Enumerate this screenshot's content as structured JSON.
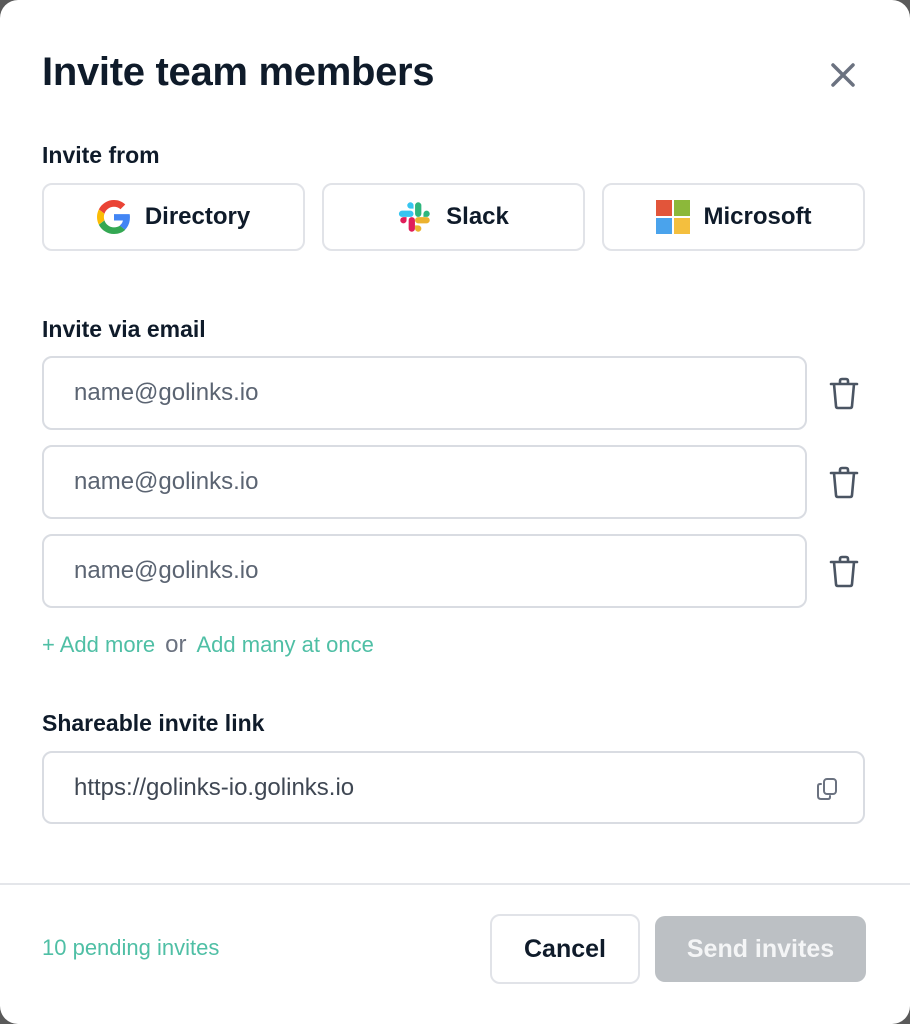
{
  "modal": {
    "title": "Invite team members",
    "close_icon": "close-icon"
  },
  "invite_from": {
    "label": "Invite from",
    "providers": [
      {
        "label": "Directory",
        "icon": "google-icon"
      },
      {
        "label": "Slack",
        "icon": "slack-icon"
      },
      {
        "label": "Microsoft",
        "icon": "microsoft-icon"
      }
    ]
  },
  "invite_email": {
    "label": "Invite via email",
    "fields": [
      {
        "placeholder": "name@golinks.io",
        "value": ""
      },
      {
        "placeholder": "name@golinks.io",
        "value": ""
      },
      {
        "placeholder": "name@golinks.io",
        "value": ""
      }
    ],
    "delete_icon": "trash-icon",
    "add_more": "+ Add more",
    "or": "or",
    "add_many": "Add many at once"
  },
  "shareable_link": {
    "label": "Shareable invite link",
    "url": "https://golinks-io.golinks.io",
    "copy_icon": "copy-icon"
  },
  "footer": {
    "pending": "10 pending invites",
    "cancel": "Cancel",
    "send": "Send invites",
    "send_disabled": true
  },
  "colors": {
    "accent": "#4fbfa5",
    "text_dark": "#0f1b2a",
    "disabled_button": "#bcc0c4"
  }
}
